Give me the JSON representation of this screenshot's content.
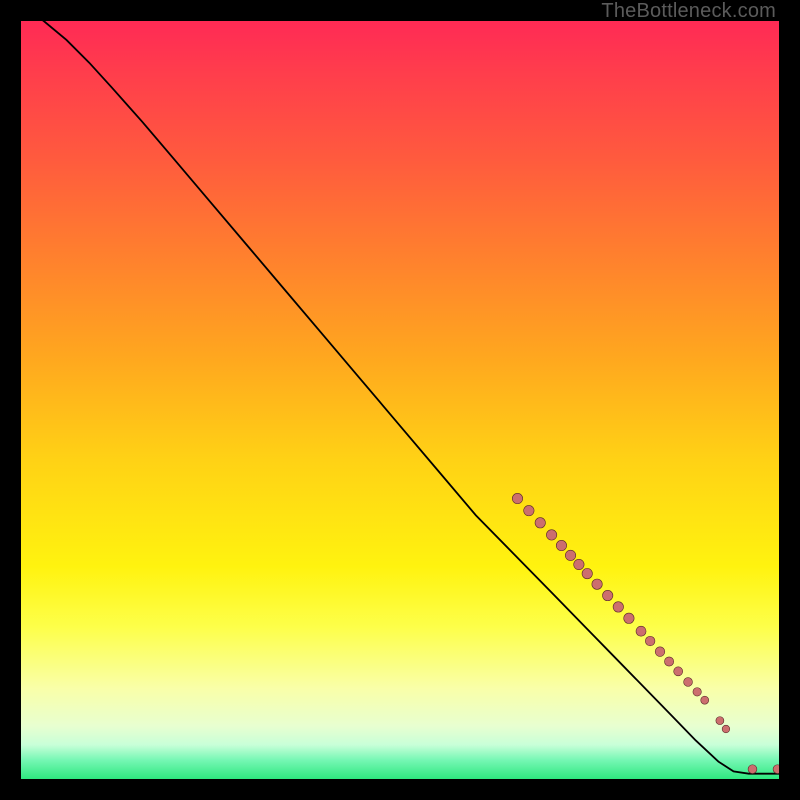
{
  "attribution": "TheBottleneck.com",
  "colors": {
    "page_bg": "#000000",
    "curve": "#000000",
    "marker_fill": "#cc6e6e",
    "marker_stroke": "#5a2a2a"
  },
  "chart_data": {
    "type": "line",
    "title": "",
    "xlabel": "",
    "ylabel": "",
    "xlim": [
      0,
      100
    ],
    "ylim": [
      0,
      100
    ],
    "grid": false,
    "curve": [
      {
        "x": 0,
        "y": 102
      },
      {
        "x": 3,
        "y": 100
      },
      {
        "x": 6,
        "y": 97.5
      },
      {
        "x": 9,
        "y": 94.5
      },
      {
        "x": 12,
        "y": 91.2
      },
      {
        "x": 16,
        "y": 86.7
      },
      {
        "x": 20,
        "y": 82.0
      },
      {
        "x": 25,
        "y": 76.1
      },
      {
        "x": 30,
        "y": 70.2
      },
      {
        "x": 35,
        "y": 64.3
      },
      {
        "x": 40,
        "y": 58.4
      },
      {
        "x": 45,
        "y": 52.5
      },
      {
        "x": 50,
        "y": 46.6
      },
      {
        "x": 55,
        "y": 40.7
      },
      {
        "x": 60,
        "y": 34.8
      },
      {
        "x": 65,
        "y": 29.7
      },
      {
        "x": 70,
        "y": 24.6
      },
      {
        "x": 74,
        "y": 20.5
      },
      {
        "x": 78,
        "y": 16.4
      },
      {
        "x": 82,
        "y": 12.3
      },
      {
        "x": 86,
        "y": 8.2
      },
      {
        "x": 89,
        "y": 5.1
      },
      {
        "x": 92,
        "y": 2.3
      },
      {
        "x": 94,
        "y": 1.0
      },
      {
        "x": 96,
        "y": 0.7
      },
      {
        "x": 98,
        "y": 0.7
      },
      {
        "x": 100,
        "y": 0.7
      }
    ],
    "markers": [
      {
        "x": 65.5,
        "y": 37.0,
        "r": 5.2
      },
      {
        "x": 67.0,
        "y": 35.4,
        "r": 5.2
      },
      {
        "x": 68.5,
        "y": 33.8,
        "r": 5.2
      },
      {
        "x": 70.0,
        "y": 32.2,
        "r": 5.2
      },
      {
        "x": 71.3,
        "y": 30.8,
        "r": 5.2
      },
      {
        "x": 72.5,
        "y": 29.5,
        "r": 5.2
      },
      {
        "x": 73.6,
        "y": 28.3,
        "r": 5.2
      },
      {
        "x": 74.7,
        "y": 27.1,
        "r": 5.2
      },
      {
        "x": 76.0,
        "y": 25.7,
        "r": 5.2
      },
      {
        "x": 77.4,
        "y": 24.2,
        "r": 5.2
      },
      {
        "x": 78.8,
        "y": 22.7,
        "r": 5.2
      },
      {
        "x": 80.2,
        "y": 21.2,
        "r": 5.2
      },
      {
        "x": 81.8,
        "y": 19.5,
        "r": 5.0
      },
      {
        "x": 83.0,
        "y": 18.2,
        "r": 4.8
      },
      {
        "x": 84.3,
        "y": 16.8,
        "r": 4.8
      },
      {
        "x": 85.5,
        "y": 15.5,
        "r": 4.6
      },
      {
        "x": 86.7,
        "y": 14.2,
        "r": 4.5
      },
      {
        "x": 88.0,
        "y": 12.8,
        "r": 4.4
      },
      {
        "x": 89.2,
        "y": 11.5,
        "r": 4.2
      },
      {
        "x": 90.2,
        "y": 10.4,
        "r": 4.0
      },
      {
        "x": 92.2,
        "y": 7.7,
        "r": 4.0
      },
      {
        "x": 93.0,
        "y": 6.6,
        "r": 3.8
      },
      {
        "x": 96.5,
        "y": 1.3,
        "r": 4.4
      },
      {
        "x": 99.8,
        "y": 1.3,
        "r": 4.4
      },
      {
        "x": 101.0,
        "y": 1.3,
        "r": 4.4
      }
    ]
  }
}
